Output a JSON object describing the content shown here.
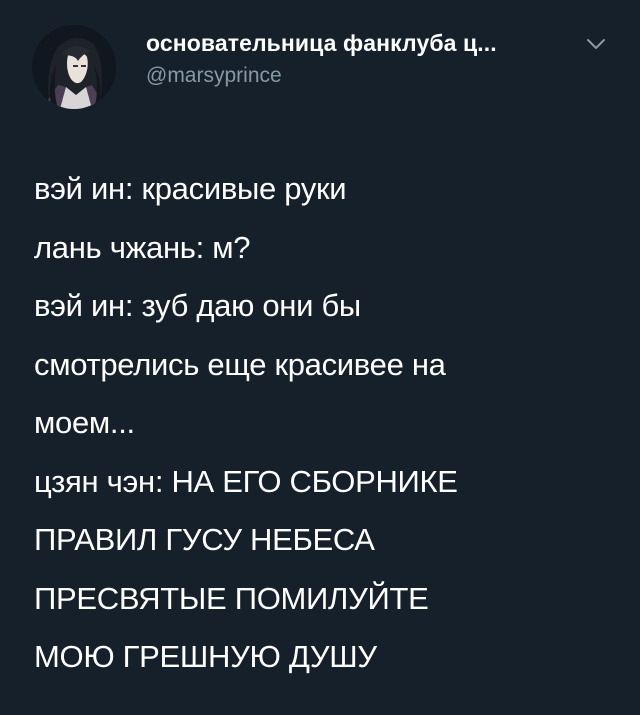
{
  "tweet": {
    "author": {
      "display_name": "основательница фанклуба ц...",
      "handle": "@marsyprince",
      "avatar_icon": "profile-avatar",
      "menu_icon": "chevron-down-icon"
    },
    "lines": [
      "вэй ин: красивые руки",
      "лань чжань: м?",
      "вэй ин: зуб даю они бы",
      "смотрелись еще красивее на",
      "моем...",
      "цзян чэн: НА ЕГО СБОРНИКЕ",
      "ПРАВИЛ ГУСУ НЕБЕСА",
      "ПРЕСВЯТЫЕ ПОМИЛУЙТЕ",
      "МОЮ ГРЕШНУЮ ДУШУ"
    ]
  },
  "colors": {
    "background": "#15202b",
    "text": "#ffffff",
    "secondary_text": "#8899a6"
  }
}
